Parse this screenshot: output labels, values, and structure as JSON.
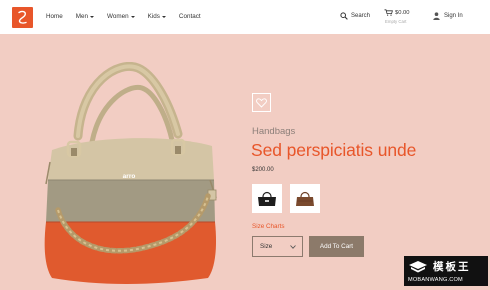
{
  "header": {
    "nav": [
      {
        "label": "Home",
        "has_dropdown": false
      },
      {
        "label": "Men",
        "has_dropdown": true
      },
      {
        "label": "Women",
        "has_dropdown": true
      },
      {
        "label": "Kids",
        "has_dropdown": true
      },
      {
        "label": "Contact",
        "has_dropdown": false
      }
    ],
    "search_label": "Search",
    "cart_total": "$0.00",
    "cart_status": "Empty Cart",
    "signin_label": "Sign In"
  },
  "product": {
    "category": "Handbags",
    "title": "Sed perspiciatis unde",
    "price": "$200.00",
    "bag_brand": "arro",
    "size_chart_label": "Size Charts",
    "size_select_value": "Size",
    "add_to_cart_label": "Add To Cart"
  },
  "watermark": {
    "brand_cn": "模板王",
    "url": "MOBANWANG.COM"
  },
  "colors": {
    "accent": "#e8562a",
    "background": "#f2cdc3",
    "button": "#8c7a6a"
  }
}
